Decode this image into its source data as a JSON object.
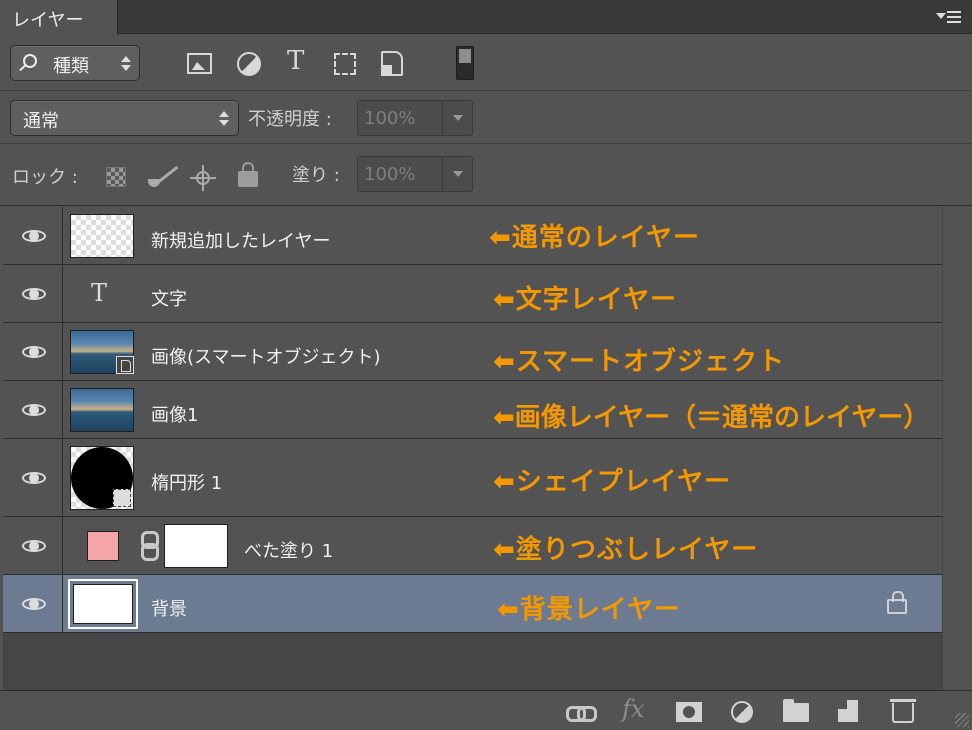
{
  "panel": {
    "tab_label": "レイヤー"
  },
  "filter": {
    "kind_label": "種類"
  },
  "blend": {
    "mode": "通常",
    "opacity_label": "不透明度 :",
    "opacity_value": "100%"
  },
  "lock": {
    "lock_label": "ロック :",
    "fill_label": "塗り :",
    "fill_value": "100%"
  },
  "layers": [
    {
      "name": "新規追加したレイヤー",
      "annotation": "⬅通常のレイヤー",
      "type": "normal"
    },
    {
      "name": "文字",
      "annotation": "⬅文字レイヤー",
      "type": "text",
      "thumb_glyph": "T"
    },
    {
      "name": "画像(スマートオブジェクト)",
      "annotation": "⬅スマートオブジェクト",
      "type": "smart-object"
    },
    {
      "name": "画像1",
      "annotation": "⬅画像レイヤー（＝通常のレイヤー）",
      "type": "image"
    },
    {
      "name": "楕円形 1",
      "annotation": "⬅シェイプレイヤー",
      "type": "shape"
    },
    {
      "name": "べた塗り 1",
      "annotation": "⬅塗りつぶしレイヤー",
      "type": "fill",
      "swatch_color": "#f4a6a6"
    },
    {
      "name": "背景",
      "annotation": "⬅背景レイヤー",
      "type": "background",
      "selected": true,
      "locked": true
    }
  ],
  "toolbar": {
    "fx_label": "fx"
  },
  "colors": {
    "annotation": "#f39800",
    "selected_row": "#6c7b91",
    "panel_bg": "#535353"
  }
}
